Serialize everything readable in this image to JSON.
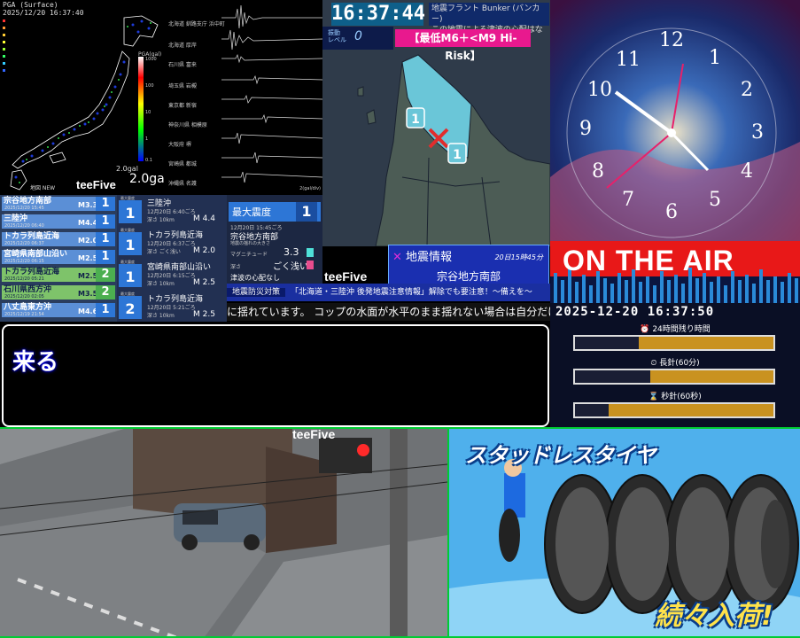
{
  "pga": {
    "title": "PGA (Surface)",
    "timestamp": "2025/12/20 16:37:40",
    "scale_label": "PGA(gal)",
    "gal_label": "2.0gal",
    "gal_value": "2.0gal",
    "brand": "teeFive",
    "legend_new": "地図 NEW"
  },
  "waves": {
    "stations": [
      "北海道 釧路支庁 浜中町",
      "北海道 厚岸",
      "石川県 富来",
      "埼玉県 岩槻",
      "東京都 新宿",
      "神奈川県 相模原",
      "大阪府 堺",
      "宮崎県 都城",
      "沖縄県 名護"
    ],
    "unit": "2(gal/div)"
  },
  "eew": {
    "clock": "16:37:44",
    "bunker_line1": "地震フラント Bunker (バンカー)",
    "bunker_line2": "この地震による津波の心配はなし",
    "level_label": "振動\nレベル",
    "level_value": "0",
    "risk": "【最低M6＋<M9 Hi-Risk】",
    "info_title": "地震情報",
    "info_time": "20日15時45分",
    "info_region": "宗谷地方南部",
    "brand": "teeFive",
    "map_badge_1": "1",
    "map_badge_2": "1"
  },
  "quakes": [
    {
      "name": "宗谷地方南部",
      "date": "2025/12/20 15:45",
      "mag": "M3.3",
      "intensity": "1",
      "bg": "#2d76d6"
    },
    {
      "name": "三陸沖",
      "date": "2025/12/20 06:40",
      "mag": "M4.4",
      "intensity": "1",
      "bg": "#2d76d6"
    },
    {
      "name": "トカラ列島近海",
      "date": "2025/12/20 06:37",
      "mag": "M2.0",
      "intensity": "1",
      "bg": "#2d76d6"
    },
    {
      "name": "宮崎県南部山沿い",
      "date": "2025/12/20 06:15",
      "mag": "M2.5",
      "intensity": "1",
      "bg": "#2d76d6"
    },
    {
      "name": "トカラ列島近海",
      "date": "2025/12/20 05:21",
      "mag": "M2.5",
      "intensity": "2",
      "bg": "#4caf50"
    },
    {
      "name": "石川県西方沖",
      "date": "2025/12/20 02:05",
      "mag": "M3.5",
      "intensity": "2",
      "bg": "#4caf50"
    },
    {
      "name": "八丈島東方沖",
      "date": "2025/12/19 21:54",
      "mag": "M4.6",
      "intensity": "1",
      "bg": "#2d76d6"
    }
  ],
  "details": [
    {
      "label": "最大震度",
      "intensity": "1",
      "name": "三陸沖",
      "time": "12月20日 6:40ごろ",
      "depth": "深さ 10km",
      "mag": "M 4.4"
    },
    {
      "label": "最大震度",
      "intensity": "1",
      "name": "トカラ列島近海",
      "time": "12月20日 6:37ごろ",
      "depth": "深さ ごく浅い",
      "mag": "M 2.0"
    },
    {
      "label": "最大震度",
      "intensity": "1",
      "name": "宮崎県南部山沿い",
      "time": "12月20日 6:15ごろ",
      "depth": "深さ 10km",
      "mag": "M 2.5"
    },
    {
      "label": "最大震度",
      "intensity": "2",
      "name": "トカラ列島近海",
      "time": "12月20日 5:21ごろ",
      "depth": "深さ 10km",
      "mag": "M 2.5"
    }
  ],
  "max_panel": {
    "title": "最大震度",
    "value": "1",
    "time": "12月20日 15:45ごろ",
    "region": "宗谷地方南部",
    "note": "地震の揺れの大きさ",
    "mag_label": "マグニチュード",
    "mag_value": "3.3",
    "depth_label": "深さ",
    "depth_value": "ごく浅い",
    "tsunami": "津波の心配なし"
  },
  "ticker": {
    "tag": "地震防災対策",
    "head": "「北海道・三陸沖 後発地震注意情報」解除でも要注意！〜備えを〜",
    "text": "に揺れています。 コップの水面が水平のまま揺れない場合は自分だけ揺"
  },
  "subtitle": {
    "text": "来る"
  },
  "onair": {
    "text": "ON THE AIR",
    "datetime": "2025-12-20 16:37:50",
    "remain_label": "24時間残り時間",
    "long_label": "長針(60分)",
    "second_label": "秒針(60秒)",
    "progress": [
      0.32,
      0.38,
      0.17
    ]
  },
  "camera": {
    "brand": "teeFive"
  },
  "ad": {
    "title": "スタッドレスタイヤ",
    "subtitle": "続々入荷!"
  },
  "colors": {
    "accent": "#2d76d6",
    "risk": "#e8198e",
    "frame": "#00cc33"
  }
}
